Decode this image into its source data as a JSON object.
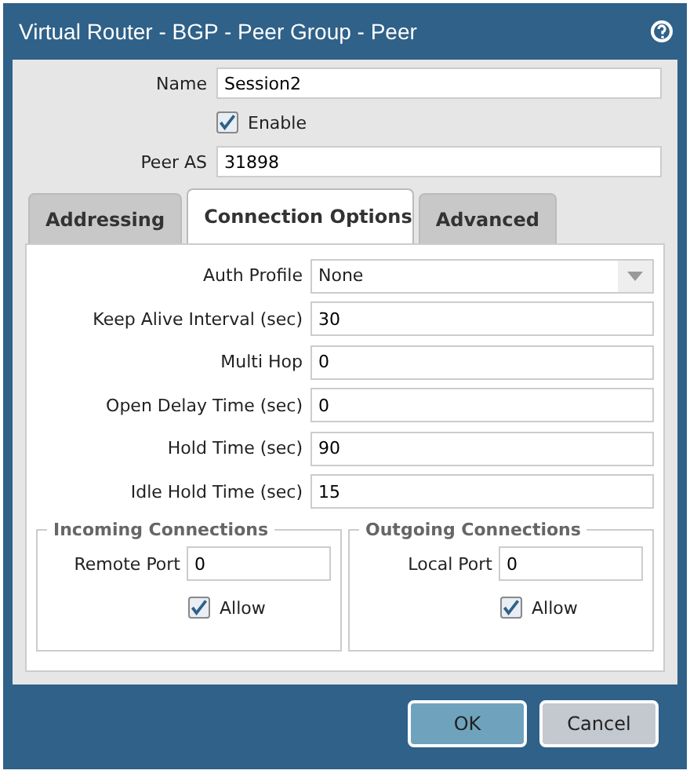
{
  "window": {
    "title": "Virtual Router - BGP - Peer Group - Peer"
  },
  "name": {
    "label": "Name",
    "value": "Session2"
  },
  "enable": {
    "label": "Enable",
    "checked": true
  },
  "peer_as": {
    "label": "Peer AS",
    "value": "31898"
  },
  "tabs": [
    {
      "label": "Addressing",
      "selected": false
    },
    {
      "label": "Connection Options",
      "selected": true
    },
    {
      "label": "Advanced",
      "selected": false
    }
  ],
  "fields": [
    {
      "kind": "select",
      "label": "Auth Profile",
      "value": "None"
    },
    {
      "kind": "text",
      "label": "Keep Alive Interval (sec)",
      "value": "30"
    },
    {
      "kind": "text",
      "label": "Multi Hop",
      "value": "0"
    },
    {
      "kind": "text",
      "label": "Open Delay Time (sec)",
      "value": "0"
    },
    {
      "kind": "text",
      "label": "Hold Time (sec)",
      "value": "90"
    },
    {
      "kind": "text",
      "label": "Idle Hold Time (sec)",
      "value": "15"
    }
  ],
  "groups": [
    {
      "title": "Incoming Connections",
      "port_label": "Remote Port",
      "port": "0",
      "allow_label": "Allow",
      "allow": true
    },
    {
      "title": "Outgoing Connections",
      "port_label": "Local Port",
      "port": "0",
      "allow_label": "Allow",
      "allow": true
    }
  ],
  "buttons": [
    {
      "label": "OK",
      "kind": "primary"
    },
    {
      "label": "Cancel",
      "kind": "secondary"
    }
  ]
}
